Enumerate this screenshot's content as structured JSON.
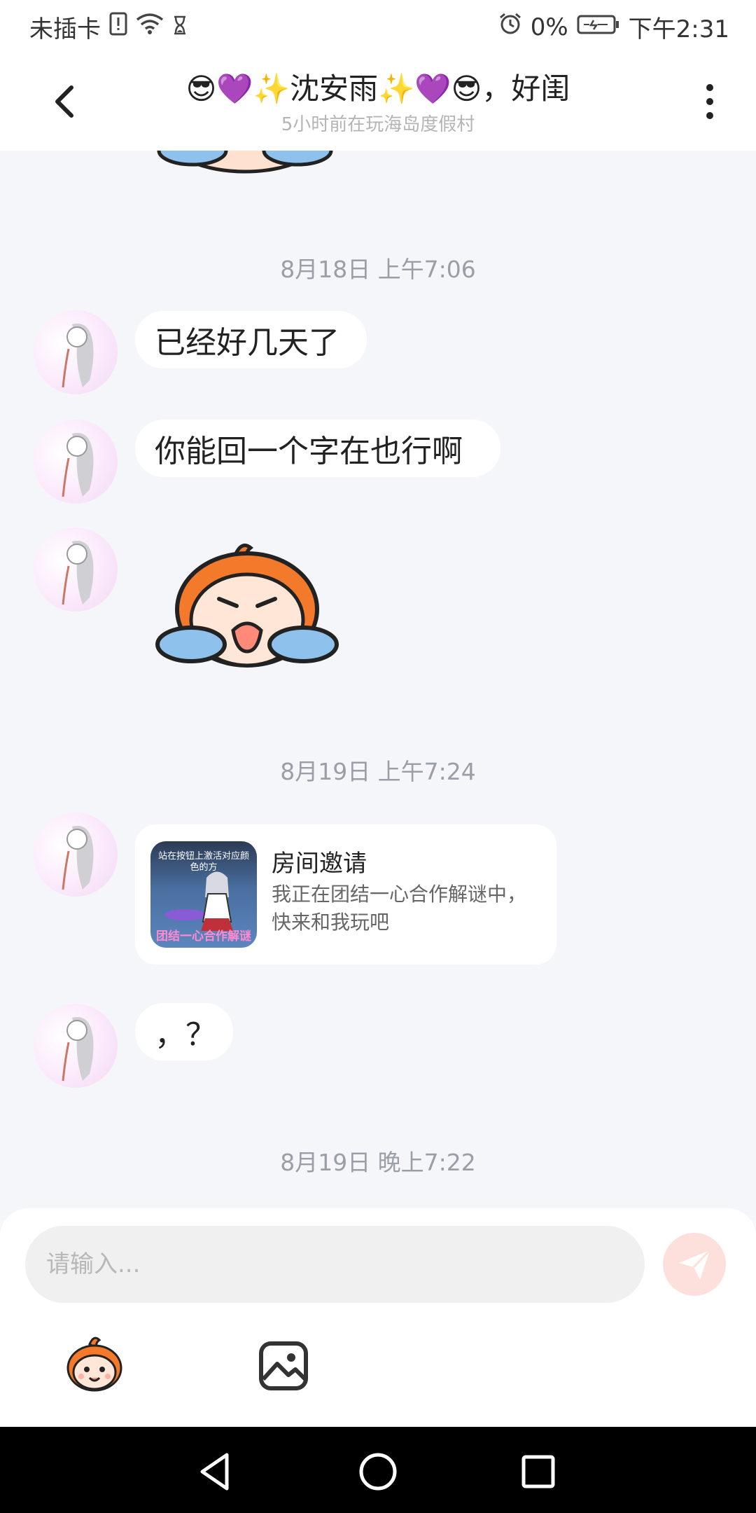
{
  "status_bar": {
    "carrier": "未插卡",
    "battery_percent": "0%",
    "time": "下午2:31",
    "icons": [
      "sim-alert-icon",
      "wifi-icon",
      "hourglass-icon",
      "alarm-icon",
      "battery-charging-icon"
    ]
  },
  "header": {
    "title": "😎💜✨沈安雨✨💜😎，好闺",
    "subtitle": "5小时前在玩海岛度假村"
  },
  "messages": {
    "ts1": "8月18日 上午7:06",
    "msg1": "已经好几天了",
    "msg2": "你能回一个字在也行啊",
    "sticker": "crying-sticker",
    "ts2": "8月19日 上午7:24",
    "invite": {
      "title": "房间邀请",
      "desc": "我正在团结一心合作解谜中，快来和我玩吧",
      "thumb_caption_top": "站在按钮上激活对应颜色的方",
      "thumb_caption_bottom": "团结一心合作解谜"
    },
    "msg3": "，？",
    "ts3": "8月19日 晚上7:22"
  },
  "composer": {
    "placeholder": "请输入..."
  },
  "colors": {
    "accent": "#ff8a5b",
    "send_disabled": "#fde0dc",
    "background": "#f4f6f9"
  }
}
